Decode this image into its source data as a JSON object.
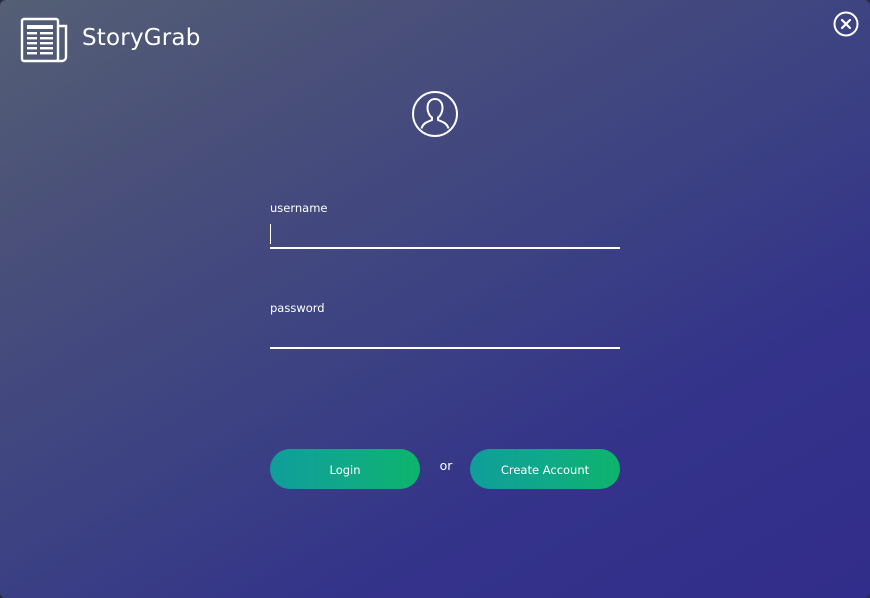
{
  "app": {
    "name": "StoryGrab",
    "logo_icon": "newspaper-icon"
  },
  "window": {
    "close_icon": "close-circle-icon"
  },
  "login_form": {
    "avatar_icon": "user-avatar-icon",
    "username": {
      "label": "username",
      "value": ""
    },
    "password": {
      "label": "password",
      "value": ""
    },
    "login_button": "Login",
    "separator": "or",
    "create_account_button": "Create Account"
  },
  "colors": {
    "background_start": "#545f75",
    "background_end": "#312d8a",
    "button_gradient_start": "#0f9d9a",
    "button_gradient_end": "#0db46b",
    "foreground": "#ffffff"
  }
}
